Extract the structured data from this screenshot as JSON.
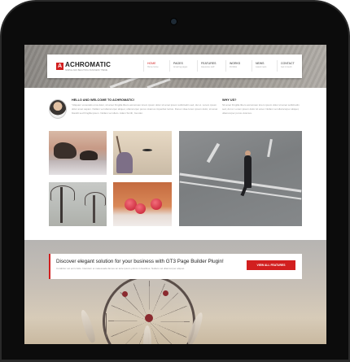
{
  "site": {
    "logo_mark": "A",
    "logo_text": "ACHROMATIC",
    "logo_tagline": "SIMPLE AND BEAUTIFUL BUSINESS THEME"
  },
  "nav": {
    "items": [
      {
        "label": "HOME",
        "sub": "Home home"
      },
      {
        "label": "PAGES",
        "sub": "Amazing pages"
      },
      {
        "label": "FEATURES",
        "sub": "Awesome stuff"
      },
      {
        "label": "WORKS",
        "sub": "Portfolio"
      },
      {
        "label": "NEWS",
        "sub": "Latest news"
      },
      {
        "label": "CONTACT",
        "sub": "Get in touch"
      }
    ]
  },
  "intro": {
    "title": "HELLO AND WELCOME TO ACHROMATIC!",
    "text": "\"Aliquam venenatis urna dolor, sit amet fringilla libero accumsan lorem ipsum dolor sit amet ipsum sollicitudin sed, dui ut. Lorem ipsum dolor amet sapien. Nullam vel ullamcorper aliquet, ullamcorper purus vivamus imperdiet luctus. Donec vitae lorem ipsum dolor, sit amet blandit sed fringilla ipsum. Nullam vel ullam. Adam Smith, founder."
  },
  "why": {
    "title": "WHY US?",
    "text": "Sit amet fringilla libero accumsan lorem ipsum dolor sit amet sollicitudin sed, dui ut. Lorem ipsum dolor sit amet. Nullam vel ullamcorper aliquet, ullamcorper purus vivamus."
  },
  "feature": {
    "title": "Discover elegant solution for your business with GT3 Page Builder Plugin!",
    "text": "Curabitur vel enim felis. Interdum et malesuada fames ac ante ipsum primis in faucibus. Nullam vel ullamcorper aliquet.",
    "button_label": "VIEW ALL FEATURES"
  },
  "colors": {
    "accent": "#d21f1f",
    "device": "#0c0c0c"
  }
}
